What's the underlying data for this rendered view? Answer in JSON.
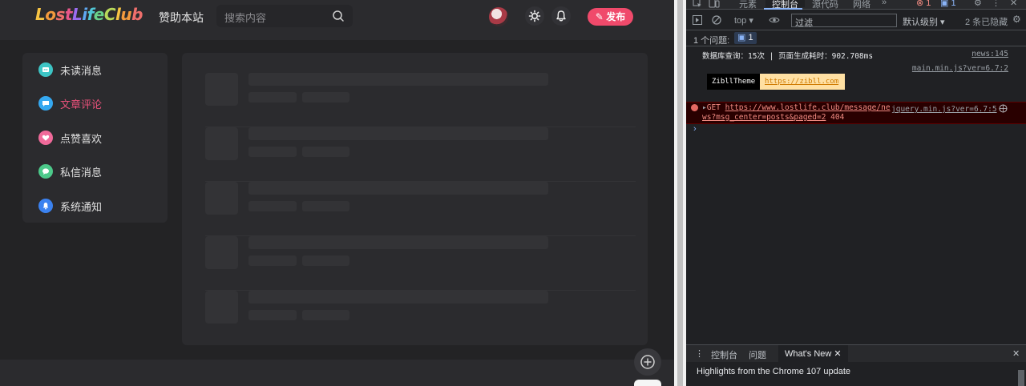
{
  "site": {
    "logo_text": "LostLifeClub",
    "nav_sponsor": "赞助本站",
    "search_placeholder": "搜索内容",
    "publish_label": "发布",
    "sidebar": [
      {
        "label": "未读消息",
        "color": "#3dc5c5",
        "icon": "message-icon",
        "active": false
      },
      {
        "label": "文章评论",
        "color": "#35a8f0",
        "icon": "comment-icon",
        "active": true
      },
      {
        "label": "点赞喜欢",
        "color": "#f06a9a",
        "icon": "heart-icon",
        "active": false
      },
      {
        "label": "私信消息",
        "color": "#4cc98a",
        "icon": "chat-icon",
        "active": false
      },
      {
        "label": "系统通知",
        "color": "#3b82f0",
        "icon": "bell-icon",
        "active": false
      }
    ],
    "colors": {
      "accent": "#f04a6b",
      "active_text": "#e8517a"
    }
  },
  "devtools": {
    "tabs": [
      "元素",
      "控制台",
      "源代码",
      "网络"
    ],
    "active_tab": "控制台",
    "error_count": "1",
    "message_count": "1",
    "context": "top",
    "filter_placeholder": "过滤",
    "levels": "默认级别",
    "hidden": "2 条已隐藏",
    "issues_label": "1 个问题:",
    "issues_count": "1",
    "log1": {
      "text": "数据库查询：15次 | 页面生成耗时：902.708ms",
      "source": "news:145"
    },
    "log2": {
      "source": "main.min.js?ver=6.7:2",
      "badge_a": "ZibllTheme",
      "badge_b": "https://zibll.com"
    },
    "error": {
      "method": "GET",
      "url": "https://www.lostlife.club/message/news?msg_center=posts&paged=2",
      "url_line1": "https://www.lostlife.club/message/ne",
      "url_line2": "ws?msg_center=posts&paged=2",
      "code": "404",
      "source": "jquery.min.js?ver=6.7:5"
    },
    "drawer_tabs": [
      "控制台",
      "问题",
      "What's New"
    ],
    "drawer_highlight": "Highlights from the Chrome 107 update"
  }
}
